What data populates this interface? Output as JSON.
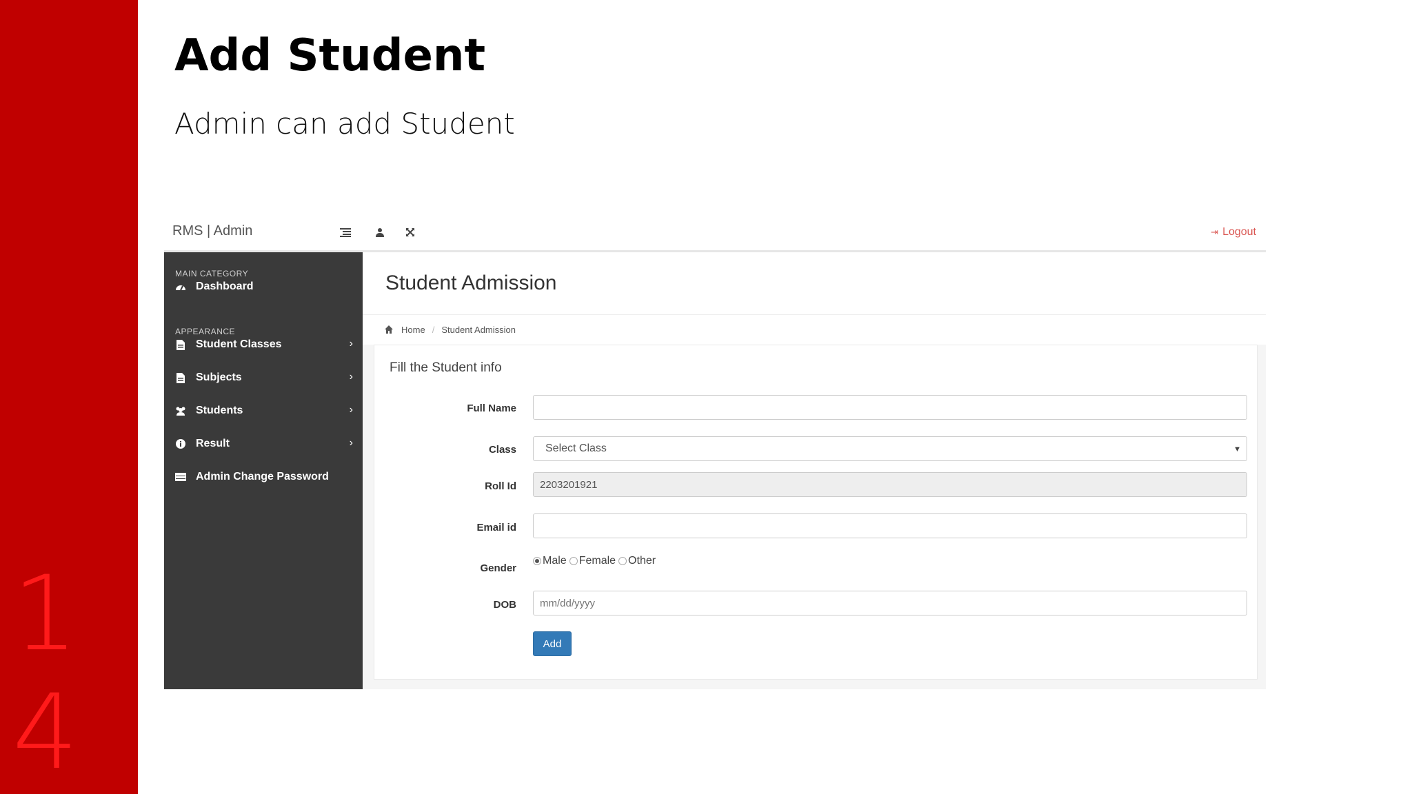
{
  "slide": {
    "title": "Add Student",
    "subtitle": "Admin can add Student",
    "number_digits": [
      "1",
      "4"
    ],
    "accent_color": "#c00000"
  },
  "topbar": {
    "brand": "RMS | Admin",
    "icons": [
      "menu-icon",
      "user-icon",
      "fullscreen-icon"
    ],
    "logout_label": "Logout"
  },
  "sidebar": {
    "main_category_label": "MAIN CATEGORY",
    "appearance_label": "APPEARANCE",
    "items": [
      {
        "label": "Dashboard",
        "icon": "dashboard-icon",
        "has_submenu": false
      },
      {
        "label": "Student Classes",
        "icon": "file-icon",
        "has_submenu": true
      },
      {
        "label": "Subjects",
        "icon": "file-icon",
        "has_submenu": true
      },
      {
        "label": "Students",
        "icon": "users-icon",
        "has_submenu": true
      },
      {
        "label": "Result",
        "icon": "info-icon",
        "has_submenu": true
      },
      {
        "label": "Admin Change Password",
        "icon": "table-icon",
        "has_submenu": false
      }
    ]
  },
  "page": {
    "title": "Student Admission",
    "breadcrumb": {
      "home": "Home",
      "current": "Student Admission"
    }
  },
  "form": {
    "panel_title": "Fill the Student info",
    "full_name": {
      "label": "Full Name",
      "value": ""
    },
    "class": {
      "label": "Class",
      "selected": "Select Class"
    },
    "roll_id": {
      "label": "Roll Id",
      "value": "2203201921"
    },
    "email": {
      "label": "Email id",
      "value": ""
    },
    "gender": {
      "label": "Gender",
      "options": [
        "Male",
        "Female",
        "Other"
      ],
      "selected": "Male"
    },
    "dob": {
      "label": "DOB",
      "placeholder": "mm/dd/yyyy"
    },
    "submit_label": "Add",
    "submit_color": "#337ab7"
  }
}
